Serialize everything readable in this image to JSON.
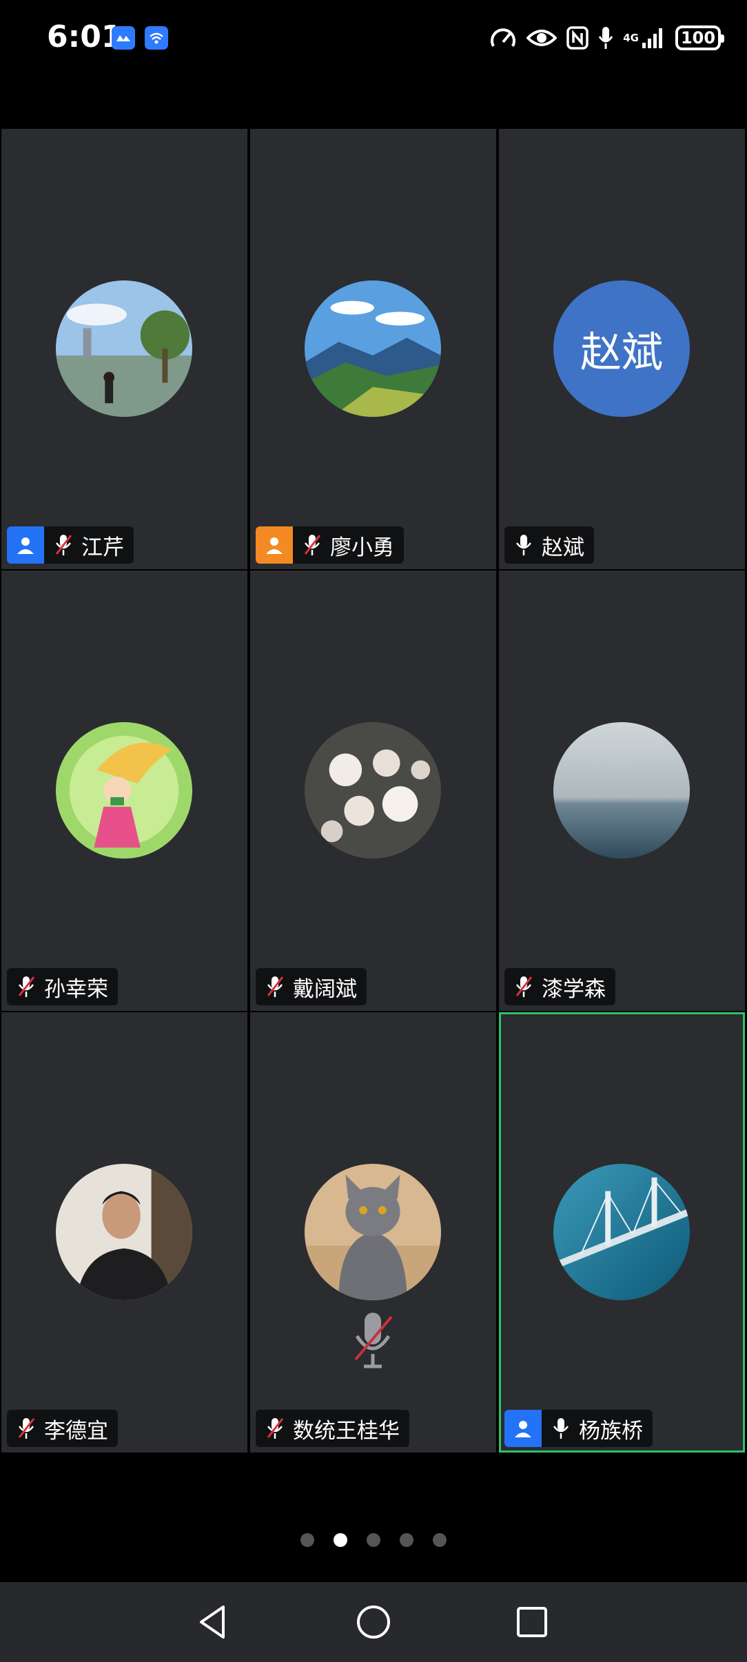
{
  "status_bar": {
    "time": "6:01",
    "network_label": "4G",
    "battery": "100",
    "icons": [
      "meet-app-icon",
      "wifi-app-icon",
      "speed-icon",
      "eye-icon",
      "nfc-icon",
      "mic-icon",
      "signal-icon",
      "battery-icon"
    ]
  },
  "participants": [
    {
      "name": "江芹",
      "avatar": "photo-lakeside-person",
      "role_badge": "blue",
      "muted": true
    },
    {
      "name": "廖小勇",
      "avatar": "photo-mountains",
      "role_badge": "orange",
      "muted": true
    },
    {
      "name": "赵斌",
      "avatar_text": "赵斌",
      "role_badge": null,
      "muted": false
    },
    {
      "name": "孙幸荣",
      "avatar": "illustration-girl",
      "role_badge": null,
      "muted": true
    },
    {
      "name": "戴阔斌",
      "avatar": "photo-blossoms",
      "role_badge": null,
      "muted": true
    },
    {
      "name": "漆学森",
      "avatar": "photo-sea",
      "role_badge": null,
      "muted": true
    },
    {
      "name": "李德宜",
      "avatar": "photo-man",
      "role_badge": null,
      "muted": true
    },
    {
      "name": "数统王桂华",
      "avatar": "photo-cat",
      "role_badge": null,
      "muted": true,
      "center_mute_icon": true
    },
    {
      "name": "杨族桥",
      "avatar": "photo-bridge",
      "role_badge": "blue",
      "muted": false,
      "active_speaker": true
    }
  ],
  "pager": {
    "total": 5,
    "current": 2
  },
  "nav": {
    "buttons": [
      "back-icon",
      "home-icon",
      "recents-icon"
    ]
  },
  "colors": {
    "tile_bg": "#2a2c30",
    "active_border": "#2dc46a",
    "badge_blue": "#2472f5",
    "badge_orange": "#f38a23",
    "avatar_blue": "#3f73c5",
    "mute_red": "#e0303a"
  }
}
